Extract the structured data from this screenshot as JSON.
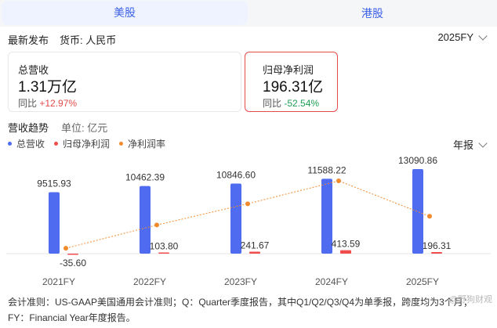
{
  "tabs": [
    {
      "label": "美股",
      "active": true
    },
    {
      "label": "港股",
      "active": false
    }
  ],
  "header": {
    "latest_release": "最新发布",
    "currency": "货币: 人民币",
    "fiscal_select": "2025FY"
  },
  "cards": [
    {
      "label": "总营收",
      "value": "1.31万亿",
      "yoy_prefix": "同比",
      "yoy": "+12.97%",
      "yoy_color": "#e34a4a"
    },
    {
      "label": "归母净利润",
      "value": "196.31亿",
      "yoy_prefix": "同比",
      "yoy": "-52.54%",
      "yoy_color": "#1f9d55"
    }
  ],
  "trend": {
    "title": "营收趋势",
    "unit": "单位: 亿元",
    "period_select": "年报"
  },
  "chart_data": {
    "type": "bar",
    "categories": [
      "2021FY",
      "2022FY",
      "2023FY",
      "2024FY",
      "2025FY"
    ],
    "series": [
      {
        "name": "总营收",
        "type": "bar",
        "color": "#4f6cf0",
        "values": [
          9515.93,
          10462.39,
          10846.6,
          11588.22,
          13090.86
        ],
        "labels": [
          "9515.93",
          "10462.39",
          "10846.60",
          "11588.22",
          "13090.86"
        ]
      },
      {
        "name": "归母净利润",
        "type": "bar",
        "color": "#f04c4c",
        "values": [
          -35.6,
          103.8,
          241.67,
          413.59,
          196.31
        ],
        "labels": [
          "-35.60",
          "103.80",
          "241.67",
          "413.59",
          "196.31"
        ]
      },
      {
        "name": "净利润率",
        "type": "line",
        "color": "#f28a2e",
        "values": [
          -0.37,
          0.99,
          2.23,
          3.57,
          1.5
        ]
      }
    ],
    "legend_position": "top-left",
    "grid": false
  },
  "footnote": "会计准则：US-GAAP美国通用会计准则；Q：Quarter季度报告，其中Q1/Q2/Q3/Q4为单季报，跨度均为3个月；FY：Financial Year年度报告。",
  "watermark": "@野狗财观"
}
